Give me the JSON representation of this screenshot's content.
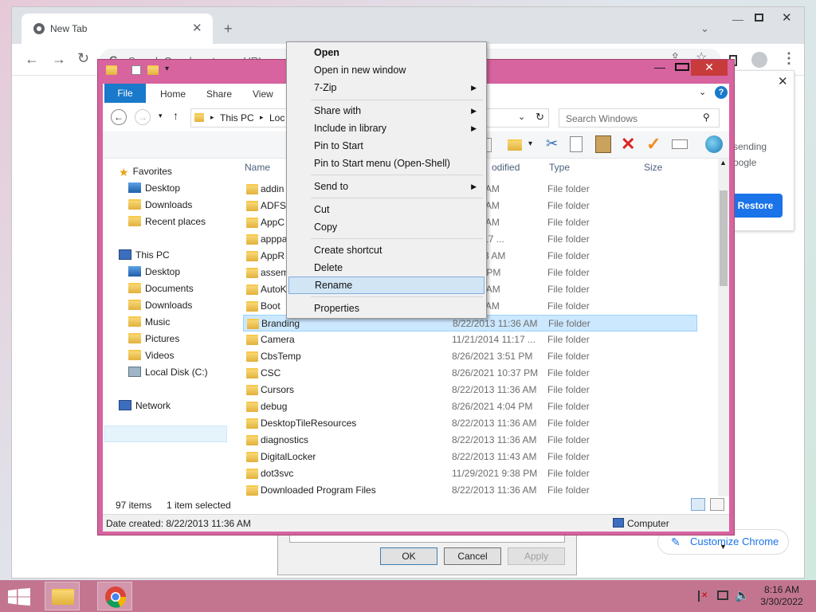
{
  "chrome": {
    "tab_title": "New Tab",
    "tab_close": "✕",
    "new_tab": "+",
    "omnibox_placeholder": "Search Google or type a URL",
    "restore_card": {
      "line1": "sending",
      "line2": "oogle",
      "button": "Restore",
      "close": "✕"
    },
    "customize_button": "Customize Chrome"
  },
  "explorer": {
    "ribbon_tabs": [
      "File",
      "Home",
      "Share",
      "View"
    ],
    "address_segments": [
      "This PC",
      "Loc"
    ],
    "search_placeholder": "Search Windows",
    "columns": {
      "name": "Name",
      "modified": "odified",
      "type": "Type",
      "size": "Size"
    },
    "nav": {
      "favorites": "Favorites",
      "fav_items": [
        "Desktop",
        "Downloads",
        "Recent places"
      ],
      "this_pc": "This PC",
      "pc_items": [
        "Desktop",
        "Documents",
        "Downloads",
        "Music",
        "Pictures",
        "Videos",
        "Local Disk (C:)"
      ],
      "network": "Network"
    },
    "files": [
      {
        "name": "addin",
        "date": "3 11:36 AM",
        "type": "File folder"
      },
      {
        "name": "ADFS",
        "date": "3 11:36 AM",
        "type": "File folder"
      },
      {
        "name": "AppC",
        "date": "3 11:36 AM",
        "type": "File folder"
      },
      {
        "name": "apppa",
        "date": "014 11:17 ...",
        "type": "File folder"
      },
      {
        "name": "AppR",
        "date": "021 3:13 AM",
        "type": "File folder"
      },
      {
        "name": "assem",
        "date": "21 3:50 PM",
        "type": "File folder"
      },
      {
        "name": "AutoK",
        "date": "21 9:28 AM",
        "type": "File folder"
      },
      {
        "name": "Boot",
        "date": "3 11:36 AM",
        "type": "File folder"
      },
      {
        "name": "Branding",
        "date": "8/22/2013 11:36 AM",
        "type": "File folder"
      },
      {
        "name": "Camera",
        "date": "11/21/2014 11:17 ...",
        "type": "File folder"
      },
      {
        "name": "CbsTemp",
        "date": "8/26/2021 3:51 PM",
        "type": "File folder"
      },
      {
        "name": "CSC",
        "date": "8/26/2021 10:37 PM",
        "type": "File folder"
      },
      {
        "name": "Cursors",
        "date": "8/22/2013 11:36 AM",
        "type": "File folder"
      },
      {
        "name": "debug",
        "date": "8/26/2021 4:04 PM",
        "type": "File folder"
      },
      {
        "name": "DesktopTileResources",
        "date": "8/22/2013 11:36 AM",
        "type": "File folder"
      },
      {
        "name": "diagnostics",
        "date": "8/22/2013 11:36 AM",
        "type": "File folder"
      },
      {
        "name": "DigitalLocker",
        "date": "8/22/2013 11:43 AM",
        "type": "File folder"
      },
      {
        "name": "dot3svc",
        "date": "11/29/2021 9:38 PM",
        "type": "File folder"
      },
      {
        "name": "Downloaded Program Files",
        "date": "8/22/2013 11:36 AM",
        "type": "File folder"
      }
    ],
    "status": {
      "count": "97 items",
      "selected": "1 item selected",
      "date_created": "Date created: 8/22/2013 11:36 AM",
      "computer": "Computer"
    }
  },
  "dialog": {
    "ok": "OK",
    "cancel": "Cancel",
    "apply": "Apply"
  },
  "context_menu": {
    "open": "Open",
    "open_new_window": "Open in new window",
    "seven_zip": "7-Zip",
    "share_with": "Share with",
    "include_in_library": "Include in library",
    "pin_to_start": "Pin to Start",
    "pin_to_start_menu": "Pin to Start menu (Open-Shell)",
    "send_to": "Send to",
    "cut": "Cut",
    "copy": "Copy",
    "create_shortcut": "Create shortcut",
    "delete": "Delete",
    "rename": "Rename",
    "properties": "Properties"
  },
  "taskbar": {
    "time": "8:16 AM",
    "date": "3/30/2022"
  },
  "colors": {
    "explorer_frame": "#d7639f",
    "taskbar": "#c37590",
    "accent": "#1a73e8",
    "file_tab": "#1979ca"
  }
}
